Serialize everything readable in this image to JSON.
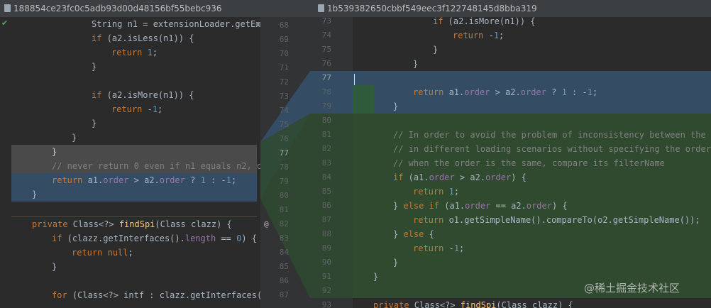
{
  "tabs": {
    "left_hash": "188854ce23fc0c5adb93d00d48156bf55bebc936",
    "right_hash": "1b539382650cbbf549eec3f122748145d8bba319"
  },
  "left_lines": [
    "        String n1 = extensionLoader.getEx",
    "        if (a2.isLess(n1)) {",
    "            return 1;",
    "        }",
    "",
    "        if (a2.isMore(n1)) {",
    "            return -1;",
    "        }",
    "    }",
    "}",
    "// never return 0 even if n1 equals n2, o",
    "return a1.order > a2.order ? 1 : -1;",
    "}",
    "",
    "private Class<?> findSpi(Class clazz) {",
    "    if (clazz.getInterfaces().length == 0) {",
    "        return null;",
    "    }",
    "",
    "    for (Class<?> intf : clazz.getInterfaces("
  ],
  "gutter_left_numbers": [
    "68",
    "69",
    "70",
    "71",
    "72",
    "73",
    "74",
    "75",
    "76",
    "77",
    "78",
    "79",
    "80",
    "81",
    "82",
    "83",
    "84",
    "85",
    "86",
    "87"
  ],
  "gutter_right_numbers": [
    "73",
    "74",
    "75",
    "76",
    "77",
    "78",
    "79",
    "80",
    "81",
    "82",
    "83",
    "84",
    "85",
    "86",
    "87",
    "88",
    "89",
    "90",
    "91",
    "92",
    "93"
  ],
  "right_lines": [
    "        if (a2.isMore(n1)) {",
    "            return -1;",
    "        }",
    "    }",
    "",
    "    return a1.order > a2.order ? 1 : -1;",
    "}",
    "",
    "// In order to avoid the problem of inconsistency between the lo",
    "// in different loading scenarios without specifying the order a",
    "// when the order is the same, compare its filterName",
    "if (a1.order > a2.order) {",
    "    return 1;",
    "} else if (a1.order == a2.order) {",
    "    return o1.getSimpleName().compareTo(o2.getSimpleName());",
    "} else {",
    "    return -1;",
    "}",
    "}",
    "",
    "private Class<?> findSpi(Class clazz) {"
  ],
  "watermark": "@稀土掘金技术社区",
  "colors": {
    "keyword": "#cc7832",
    "field": "#9876aa",
    "number": "#6897bb",
    "method": "#ffc66d",
    "comment": "#808080"
  }
}
